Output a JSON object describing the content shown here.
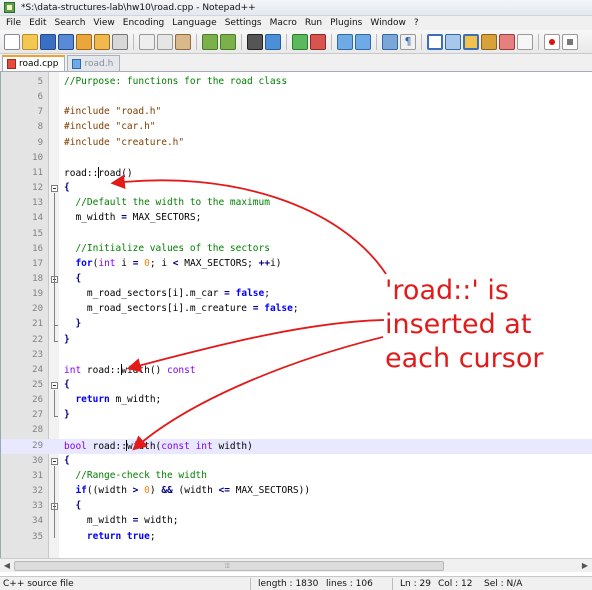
{
  "window": {
    "title": "*S:\\data-structures-lab\\hw10\\road.cpp - Notepad++"
  },
  "menu": [
    "File",
    "Edit",
    "Search",
    "View",
    "Encoding",
    "Language",
    "Settings",
    "Macro",
    "Run",
    "Plugins",
    "Window",
    "?"
  ],
  "toolbar": {
    "icons": [
      "new-file-icon",
      "open-file-icon",
      "save-icon",
      "save-all-icon",
      "close-icon",
      "close-all-icon",
      "print-icon",
      "cut-icon",
      "copy-icon",
      "paste-icon",
      "undo-icon",
      "redo-icon",
      "find-icon",
      "replace-icon",
      "zoom-in-icon",
      "zoom-out-icon",
      "sync-vertical-icon",
      "sync-horizontal-icon",
      "word-wrap-icon",
      "show-all-chars-icon",
      "indent-guide-icon",
      "doc-map-icon",
      "function-list-icon",
      "folder-workspace-icon",
      "monitor-icon",
      "record-macro-icon",
      "stop-record-icon"
    ]
  },
  "tabs": [
    {
      "label": "road.cpp",
      "active": true,
      "modified": true
    },
    {
      "label": "road.h",
      "active": false,
      "modified": false
    }
  ],
  "editor": {
    "current_line": 29,
    "lines": [
      {
        "n": "5",
        "html": "<span class='cm'>//Purpose: functions for the road class</span>"
      },
      {
        "n": "6",
        "html": ""
      },
      {
        "n": "7",
        "html": "<span class='pp'>#include \"road.h\"</span>"
      },
      {
        "n": "8",
        "html": "<span class='pp'>#include \"car.h\"</span>"
      },
      {
        "n": "9",
        "html": "<span class='pp'>#include \"creature.h\"</span>"
      },
      {
        "n": "10",
        "html": ""
      },
      {
        "n": "11",
        "html": "road::<i class='cursor'></i>road()"
      },
      {
        "n": "12",
        "html": "<span class='op'>{</span>"
      },
      {
        "n": "13",
        "html": "  <span class='cm'>//Default the width to the maximum</span>"
      },
      {
        "n": "14",
        "html": "  m_width <span class='op'>=</span> MAX_SECTORS;"
      },
      {
        "n": "15",
        "html": ""
      },
      {
        "n": "16",
        "html": "  <span class='cm'>//Initialize values of the sectors</span>"
      },
      {
        "n": "17",
        "html": "  <span class='kw'>for</span>(<span class='ty'>int</span> i <span class='op'>=</span> <span class='num'>0</span>; i <span class='op'>&lt;</span> MAX_SECTORS; <span class='op'>++</span>i)"
      },
      {
        "n": "18",
        "html": "  <span class='op'>{</span>"
      },
      {
        "n": "19",
        "html": "    m_road_sectors[i].m_car <span class='op'>=</span> <span class='kw'>false</span>;"
      },
      {
        "n": "20",
        "html": "    m_road_sectors[i].m_creature <span class='op'>=</span> <span class='kw'>false</span>;"
      },
      {
        "n": "21",
        "html": "  <span class='op'>}</span>"
      },
      {
        "n": "22",
        "html": "<span class='op'>}</span>"
      },
      {
        "n": "23",
        "html": ""
      },
      {
        "n": "24",
        "html": "<span class='ty'>int</span> road::<i class='cursor'></i>width() <span class='ty'>const</span>"
      },
      {
        "n": "25",
        "html": "<span class='op'>{</span>"
      },
      {
        "n": "26",
        "html": "  <span class='kw'>return</span> m_width;"
      },
      {
        "n": "27",
        "html": "<span class='op'>}</span>"
      },
      {
        "n": "28",
        "html": ""
      },
      {
        "n": "29",
        "html": "<span class='ty'>bool</span> road::<i class='cursor'></i>width(<span class='ty'>const int</span> width)"
      },
      {
        "n": "30",
        "html": "<span class='op'>{</span>"
      },
      {
        "n": "31",
        "html": "  <span class='cm'>//Range-check the width</span>"
      },
      {
        "n": "32",
        "html": "  <span class='kw'>if</span>((width <span class='op'>&gt;</span> <span class='num'>0</span>) <span class='op'>&amp;&amp;</span> (width <span class='op'>&lt;=</span> MAX_SECTORS))"
      },
      {
        "n": "33",
        "html": "  <span class='op'>{</span>"
      },
      {
        "n": "34",
        "html": "    m_width <span class='op'>=</span> width;"
      },
      {
        "n": "35",
        "html": "    <span class='kw'>return true</span>;"
      }
    ]
  },
  "annotation": {
    "text": "'road::' is\ninserted at\neach cursor"
  },
  "statusbar": {
    "language": "C++ source file",
    "length": "length : 1830",
    "lines": "lines : 106",
    "position": "Ln : 29",
    "column": "Col : 12",
    "selection": "Sel : N/A"
  },
  "colors": {
    "annotation": "#e21a1a",
    "current_line": "#e8e8ff",
    "active_tab_accent": "#f3a033"
  }
}
